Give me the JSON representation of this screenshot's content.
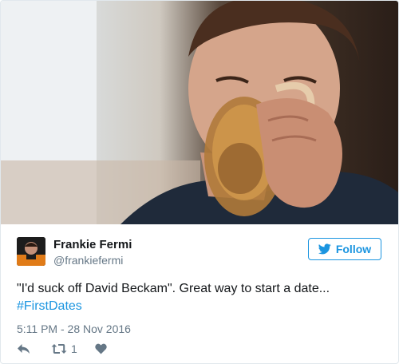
{
  "tweet": {
    "author_name": "Frankie Fermi",
    "author_handle": "@frankiefermi",
    "follow_label": "Follow",
    "text": "\"I'd suck off David Beckam\". Great way to start a date...",
    "hashtag": "#FirstDates",
    "timestamp": "5:11 PM - 28 Nov 2016",
    "retweet_count": "1"
  },
  "icons": {
    "follow": "twitter-bird-icon",
    "reply": "reply-icon",
    "retweet": "retweet-icon",
    "like": "heart-icon"
  },
  "colors": {
    "accent": "#1b95e0",
    "text": "#14171a",
    "muted": "#657786",
    "border": "#e1e8ed"
  }
}
